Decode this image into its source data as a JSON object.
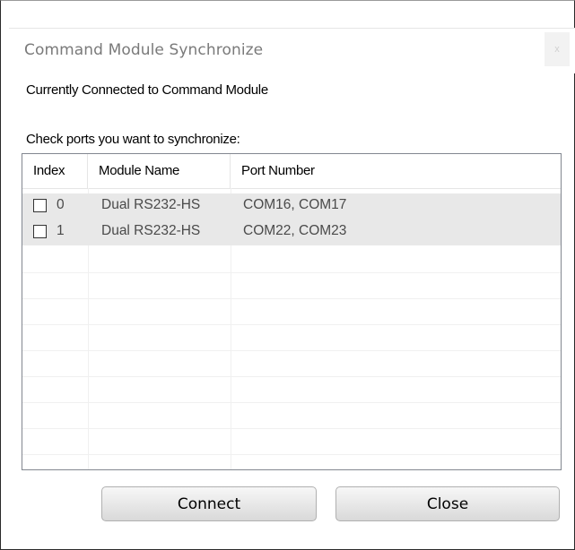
{
  "window": {
    "title": "Command Module Synchronize",
    "close_glyph": "x",
    "close_icon": "close-icon"
  },
  "status_text": "Currently Connected to Command Module",
  "instruction_text": "Check ports you want to synchronize:",
  "table": {
    "columns": [
      "Index",
      "Module Name",
      "Port Number"
    ],
    "rows": [
      {
        "checked": false,
        "index": "0",
        "module": "Dual RS232-HS",
        "ports": "COM16, COM17"
      },
      {
        "checked": false,
        "index": "1",
        "module": "Dual RS232-HS",
        "ports": "COM22, COM23"
      }
    ]
  },
  "buttons": {
    "connect": "Connect",
    "close": "Close"
  }
}
